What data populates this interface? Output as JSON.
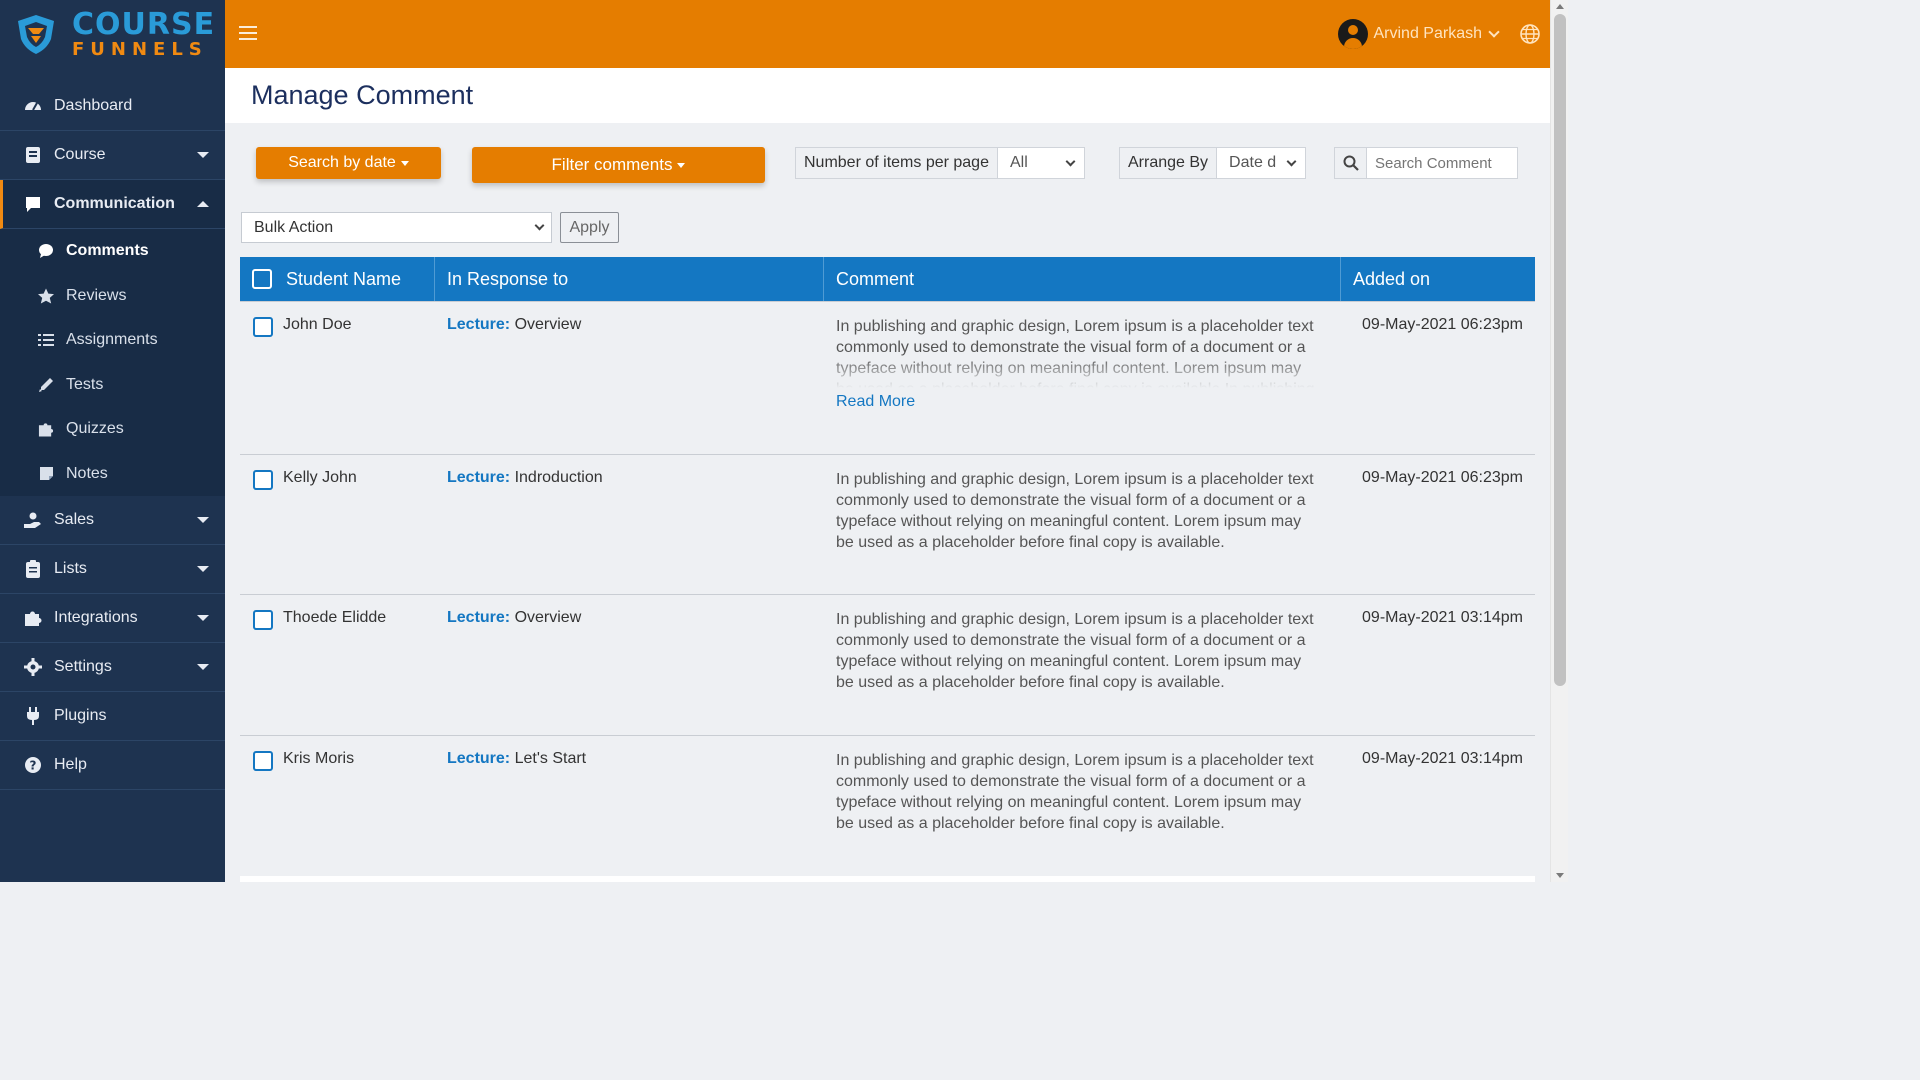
{
  "brand": {
    "line1": "COURSE",
    "line2": "FUNNELS"
  },
  "sidebar": {
    "items": [
      {
        "label": "Dashboard",
        "icon": "dashboard-gauge-icon"
      },
      {
        "label": "Course",
        "icon": "book-icon"
      },
      {
        "label": "Communication",
        "icon": "chat-bubble-icon"
      },
      {
        "label": "Sales",
        "icon": "hand-coin-icon"
      },
      {
        "label": "Lists",
        "icon": "clipboard-icon"
      },
      {
        "label": "Integrations",
        "icon": "puzzle-icon"
      },
      {
        "label": "Settings",
        "icon": "gear-icon"
      },
      {
        "label": "Plugins",
        "icon": "plug-icon"
      },
      {
        "label": "Help",
        "icon": "question-circle-icon"
      }
    ],
    "communication_sub": [
      {
        "label": "Comments",
        "icon": "comment-icon"
      },
      {
        "label": "Reviews",
        "icon": "star-icon"
      },
      {
        "label": "Assignments",
        "icon": "list-icon"
      },
      {
        "label": "Tests",
        "icon": "pen-icon"
      },
      {
        "label": "Quizzes",
        "icon": "puzzle-piece-icon"
      },
      {
        "label": "Notes",
        "icon": "note-icon"
      }
    ]
  },
  "header": {
    "user_name": "Arvind Parkash"
  },
  "page": {
    "title": "Manage Comment"
  },
  "toolbar": {
    "search_by_date": "Search by date",
    "filter_comments": "Filter comments",
    "items_per_page_label": "Number of items per page",
    "items_per_page_value": "All",
    "arrange_by_label": "Arrange By",
    "arrange_by_value": "Date d",
    "search_placeholder": "Search Comment",
    "bulk_action": "Bulk Action",
    "apply": "Apply"
  },
  "table": {
    "headers": [
      "Student Name",
      "In Response to",
      "Comment",
      "Added on"
    ],
    "response_prefix": "Lecture:",
    "read_more": "Read More",
    "rows": [
      {
        "name": "John Doe",
        "response": "Overview",
        "comment": "In publishing and graphic design, Lorem ipsum is a placeholder text commonly used to demonstrate the visual form of a document or a typeface without relying on meaningful content. Lorem ipsum may be used as a placeholder before final copy is available.In publishing",
        "added": "09-May-2021 06:23pm"
      },
      {
        "name": "Kelly John",
        "response": "Indroduction",
        "comment": "In publishing and graphic design, Lorem ipsum is a placeholder text commonly used to demonstrate the visual form of a document or a typeface without relying on meaningful content. Lorem ipsum may be used as a placeholder before final copy is available.",
        "added": "09-May-2021 06:23pm"
      },
      {
        "name": "Thoede Elidde",
        "response": "Overview",
        "comment": "In publishing and graphic design, Lorem ipsum is a placeholder text commonly used to demonstrate the visual form of a document or a typeface without relying on meaningful content. Lorem ipsum may be used as a placeholder before final copy is available.",
        "added": "09-May-2021 03:14pm"
      },
      {
        "name": "Kris Moris",
        "response": "Let's Start",
        "comment": "In publishing and graphic design, Lorem ipsum is a placeholder text commonly used to demonstrate the visual form of a document or a typeface without relying on meaningful content. Lorem ipsum may be used as a placeholder before final copy is available.",
        "added": "09-May-2021 03:14pm"
      }
    ]
  },
  "colors": {
    "accent": "#e57d00",
    "sidebar": "#1e3350",
    "table_header": "#1477c2",
    "title": "#1c2f5e"
  }
}
